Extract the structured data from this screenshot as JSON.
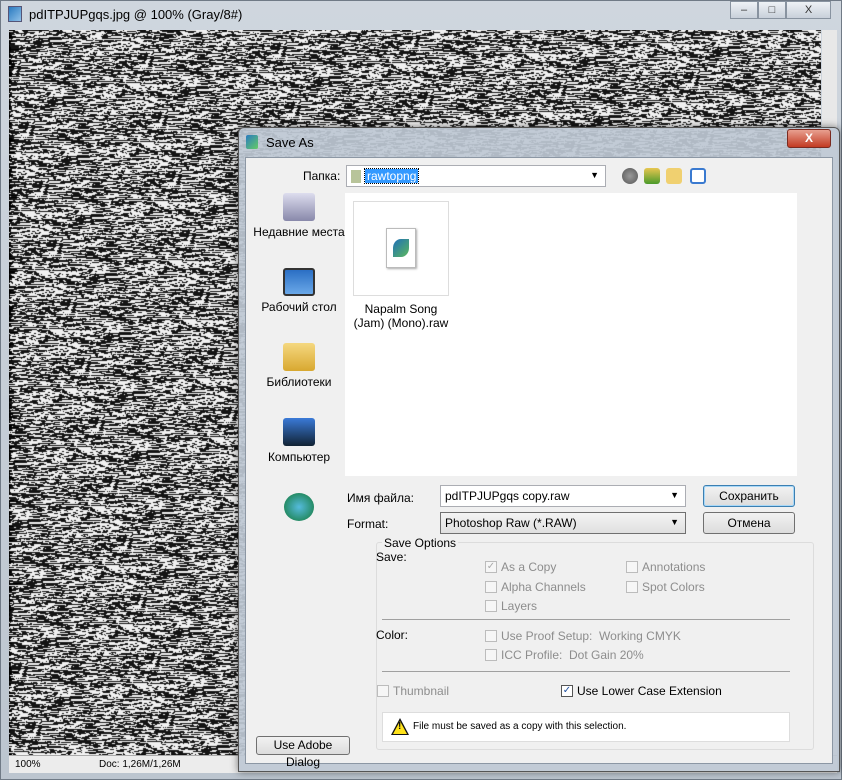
{
  "window": {
    "title": "pdITPJUPgqs.jpg @ 100% (Gray/8#)",
    "minimize": "–",
    "maximize": "□",
    "close": "X"
  },
  "status": {
    "zoom": "100%",
    "doc": "Doc: 1,26M/1,26M"
  },
  "dialog": {
    "title": "Save As",
    "close": "X",
    "folder_label": "Папка:",
    "folder_value": "rawtopng",
    "toolbar_icons": [
      "back-icon",
      "up-folder-icon",
      "new-folder-icon",
      "view-menu-icon"
    ],
    "places": [
      {
        "label": "Недавние места",
        "icon": "recent-places-icon"
      },
      {
        "label": "Рабочий стол",
        "icon": "desktop-icon"
      },
      {
        "label": "Библиотеки",
        "icon": "libraries-icon"
      },
      {
        "label": "Компьютер",
        "icon": "computer-icon"
      },
      {
        "label": "",
        "icon": "network-icon"
      }
    ],
    "files": [
      {
        "name": "Napalm Song (Jam) (Mono).raw"
      }
    ],
    "filename_label": "Имя файла:",
    "filename_value": "pdITPJUPgqs copy.raw",
    "format_label": "Format:",
    "format_value": "Photoshop Raw (*.RAW)",
    "save_button": "Сохранить",
    "cancel_button": "Отмена",
    "save_options": {
      "title": "Save Options",
      "save_label": "Save:",
      "as_copy": {
        "label": "As a Copy",
        "checked": true,
        "enabled": false
      },
      "alpha_channels": {
        "label": "Alpha Channels",
        "checked": false,
        "enabled": false
      },
      "layers": {
        "label": "Layers",
        "checked": false,
        "enabled": false
      },
      "annotations": {
        "label": "Annotations",
        "checked": false,
        "enabled": false
      },
      "spot_colors": {
        "label": "Spot Colors",
        "checked": false,
        "enabled": false
      },
      "color_label": "Color:",
      "use_proof": {
        "label": "Use Proof Setup:  Working CMYK",
        "checked": false,
        "enabled": false
      },
      "icc_profile": {
        "label": "ICC Profile:  Dot Gain 20%",
        "checked": false,
        "enabled": false
      },
      "thumbnail": {
        "label": "Thumbnail",
        "checked": false,
        "enabled": false
      },
      "lower_case": {
        "label": "Use Lower Case Extension",
        "checked": true,
        "enabled": true
      },
      "warning": "File must be saved as a copy with this selection."
    },
    "adobe_dialog_button": "Use Adobe Dialog"
  }
}
